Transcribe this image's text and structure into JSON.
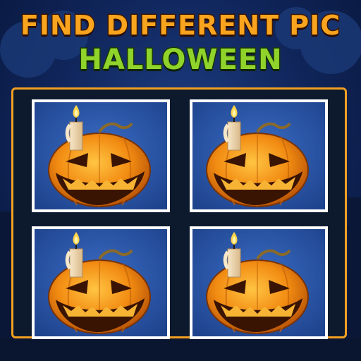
{
  "header": {
    "title_line1": "FIND DIFFERENT PIC",
    "title_line2": "HALLOWEEN"
  },
  "colors": {
    "title_line1": "#f9a41e",
    "title_line2": "#8fd32b",
    "board_border": "#f3a020",
    "card_border": "#ffffff",
    "card_background": "#2c56a8"
  },
  "cards": [
    {
      "icon": "jack-o-lantern-with-candle-icon"
    },
    {
      "icon": "jack-o-lantern-with-candle-icon"
    },
    {
      "icon": "jack-o-lantern-with-candle-icon"
    },
    {
      "icon": "jack-o-lantern-with-candle-icon"
    }
  ]
}
